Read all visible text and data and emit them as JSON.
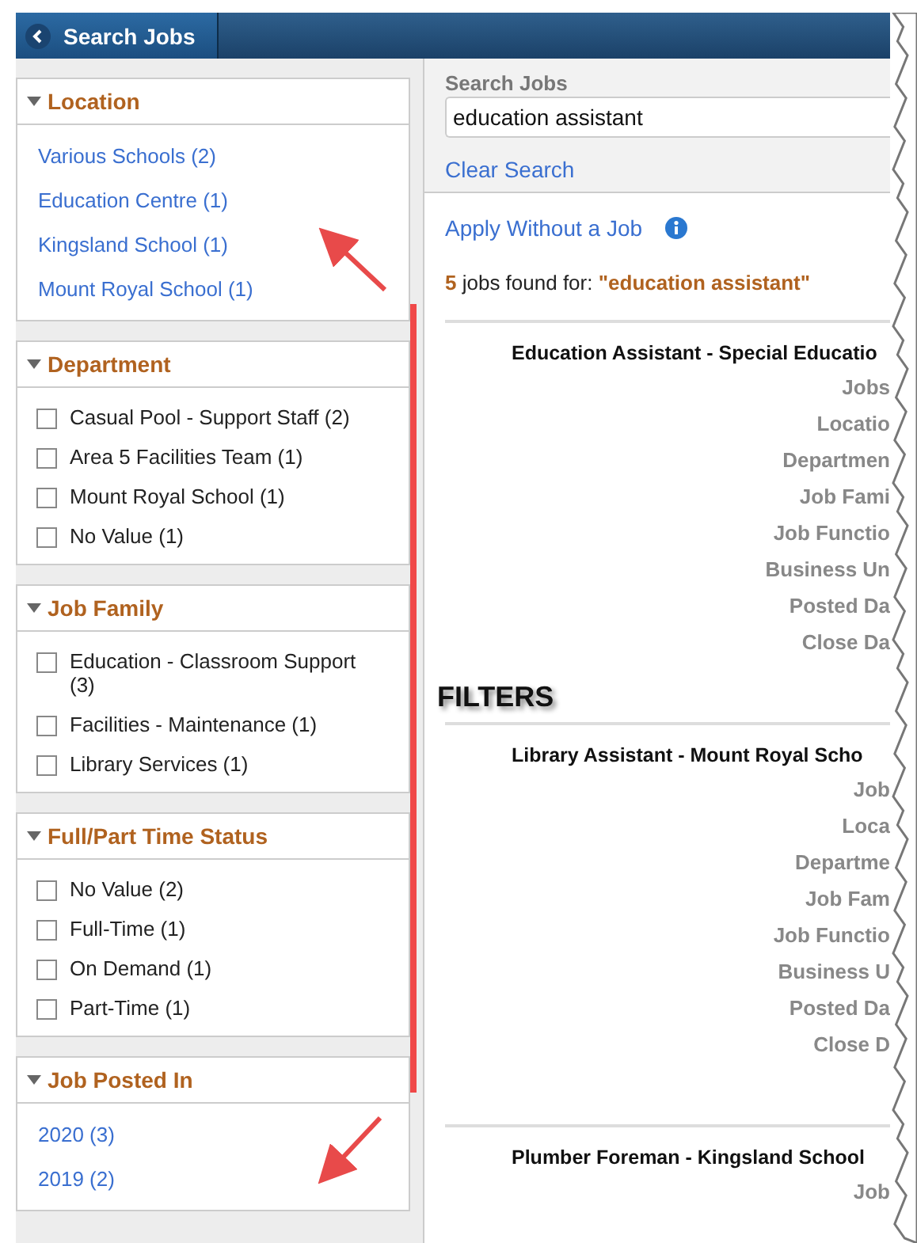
{
  "header": {
    "back_button": "Search Jobs"
  },
  "filters": [
    {
      "title": "Location",
      "expanded": true,
      "kind": "link",
      "options": [
        {
          "label": "Various Schools (2)"
        },
        {
          "label": "Education Centre (1)"
        },
        {
          "label": "Kingsland School (1)"
        },
        {
          "label": "Mount Royal School (1)"
        }
      ]
    },
    {
      "title": "Department",
      "expanded": true,
      "kind": "checkbox",
      "options": [
        {
          "label": "Casual Pool - Support Staff (2)",
          "checked": false
        },
        {
          "label": "Area 5 Facilities Team (1)",
          "checked": false
        },
        {
          "label": "Mount Royal School (1)",
          "checked": false
        },
        {
          "label": "No Value (1)",
          "checked": false
        }
      ]
    },
    {
      "title": "Job Family",
      "expanded": true,
      "kind": "checkbox",
      "options": [
        {
          "label": "Education - Classroom Support (3)",
          "checked": false
        },
        {
          "label": "Facilities - Maintenance (1)",
          "checked": false
        },
        {
          "label": "Library Services (1)",
          "checked": false
        }
      ]
    },
    {
      "title": "Full/Part Time Status",
      "expanded": true,
      "kind": "checkbox",
      "options": [
        {
          "label": "No Value (2)",
          "checked": false
        },
        {
          "label": "Full-Time (1)",
          "checked": false
        },
        {
          "label": "On Demand (1)",
          "checked": false
        },
        {
          "label": "Part-Time (1)",
          "checked": false
        }
      ]
    },
    {
      "title": "Job Posted In",
      "expanded": true,
      "kind": "link",
      "options": [
        {
          "label": "2020 (3)"
        },
        {
          "label": "2019 (2)"
        }
      ]
    }
  ],
  "search": {
    "label": "Search Jobs",
    "value": "education assistant",
    "clear_link": "Clear Search"
  },
  "apply_link": "Apply Without a Job",
  "results_summary": "**5** jobs found for: **\"education assistant\"**",
  "jobs": [
    {
      "title": "Education Assistant - Special Educatio",
      "fields": [
        "Jobs",
        "Locatio",
        "Departmen",
        "Job Fami",
        "Job Functio",
        "Business Un",
        "Posted Da",
        "Close Da"
      ]
    },
    {
      "title": "Library Assistant - Mount Royal Scho",
      "fields": [
        "Job",
        "Loca",
        "Departme",
        "Job Fam",
        "Job Functio",
        "Business U",
        "Posted Da",
        "Close D"
      ]
    },
    {
      "title": "Plumber Foreman - Kingsland School",
      "fields": [
        "Job"
      ]
    }
  ],
  "annotation": {
    "label": "FILTERS"
  }
}
